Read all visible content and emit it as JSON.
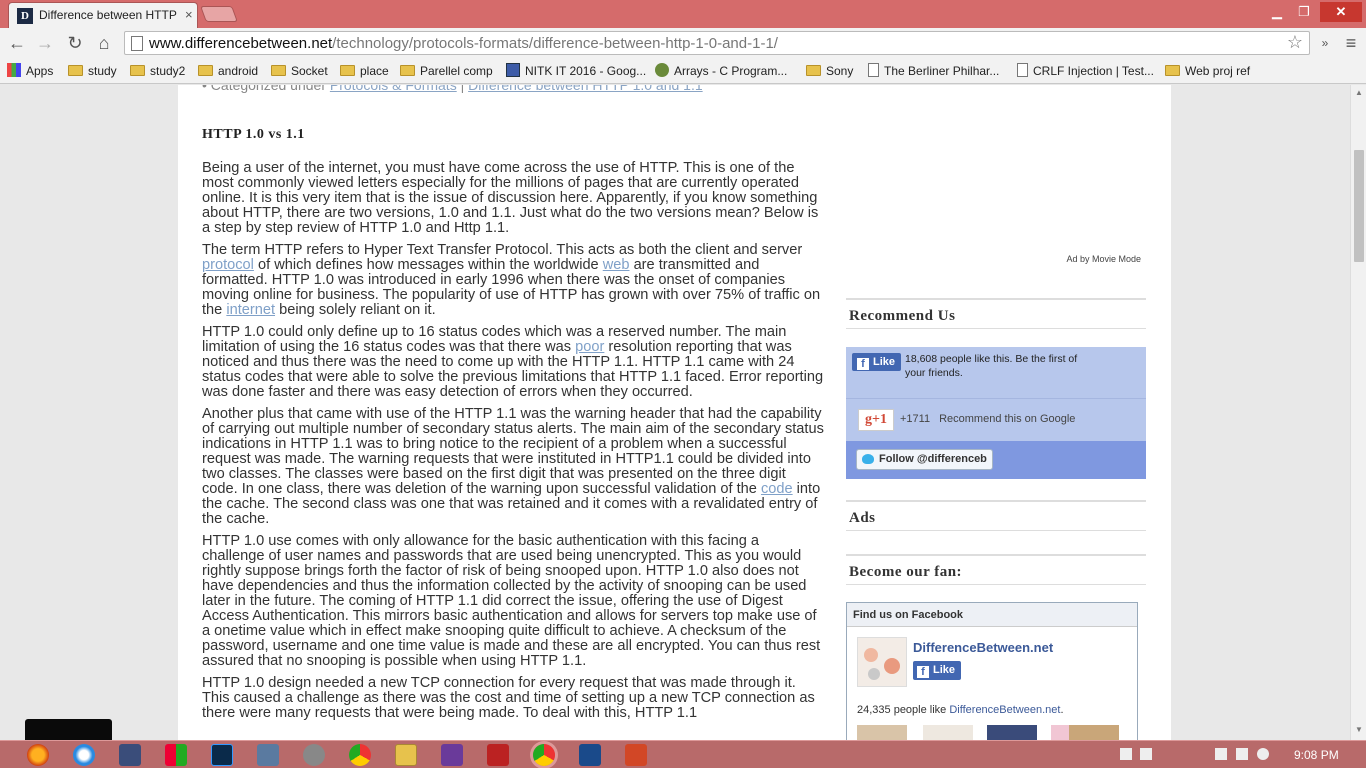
{
  "browser": {
    "tab_title": "Difference between HTTP",
    "favicon_letter": "D",
    "url_host": "www.differencebetween.net",
    "url_path": "/technology/protocols-formats/difference-between-http-1-0-and-1-1/",
    "bookmarks": [
      {
        "label": "Apps",
        "icon": "apps-grid-icon"
      },
      {
        "label": "study",
        "icon": "folder-icon"
      },
      {
        "label": "study2",
        "icon": "folder-icon"
      },
      {
        "label": "android",
        "icon": "folder-icon"
      },
      {
        "label": "Socket",
        "icon": "folder-icon"
      },
      {
        "label": "place",
        "icon": "folder-icon"
      },
      {
        "label": "Parellel comp",
        "icon": "folder-icon"
      },
      {
        "label": "NITK IT 2016 - Goog...",
        "icon": "google-form-icon"
      },
      {
        "label": "Arrays - C Program...",
        "icon": "dragon-icon"
      },
      {
        "label": "Sony",
        "icon": "folder-icon"
      },
      {
        "label": "The Berliner Philhar...",
        "icon": "page-icon"
      },
      {
        "label": "CRLF Injection | Test...",
        "icon": "page-icon"
      },
      {
        "label": "Web proj ref",
        "icon": "folder-icon"
      }
    ]
  },
  "article": {
    "crumb_prefix": "• Categorized under",
    "crumb_link1": "Protocols & Formats",
    "crumb_sep": " | ",
    "crumb_link2": "Difference between HTTP 1.0 and 1.1",
    "title": "HTTP 1.0 vs 1.1",
    "p1": "Being a user of the internet, you must have come across the use of HTTP. This is one of the most commonly viewed letters especially for the millions of pages that are currently operated online. It is this very item that is the issue of discussion here. Apparently, if you know something about HTTP, there are two versions, 1.0 and 1.1. Just what do the two versions mean? Below is a step by step review of HTTP 1.0 and Http 1.1.",
    "p2_a": "The term HTTP refers to Hyper Text Transfer Protocol. This acts as both the client and server ",
    "p2_link1": "protocol",
    "p2_b": " of which defines how messages within the worldwide ",
    "p2_link2": "web",
    "p2_c": " are transmitted and formatted. HTTP 1.0 was introduced in early 1996 when there was the onset of companies moving online for business.  The popularity of use of HTTP has grown with over 75% of traffic on the ",
    "p2_link3": "internet",
    "p2_d": " being solely reliant on it.",
    "p3_a": "HTTP 1.0 could only define up to 16 status codes which was a reserved number. The main limitation of using the 16 status codes was that there was ",
    "p3_link": "poor",
    "p3_b": " resolution reporting that was noticed and thus there was the need to come up with the HTTP 1.1. HTTP 1.1 came with 24 status codes that were able to solve the previous limitations that HTTP 1.1 faced. Error reporting was done faster and there was easy detection of errors when they occurred.",
    "p4_a": "Another plus that came with use of the HTTP 1.1 was the warning header that had the capability of carrying out multiple number of secondary status alerts. The main aim of the secondary status indications in HTTP 1.1 was to bring notice to the recipient of a problem when a successful request was made. The warning requests that were instituted in HTTP1.1 could be divided into two classes.  The classes were based on the first digit that was presented on the three digit code.  In one class, there was deletion of the warning upon successful validation of the ",
    "p4_link": "code",
    "p4_b": " into the cache. The second class was one that was retained and it comes with a revalidated entry of the cache.",
    "p5": "HTTP 1.0 use comes with only allowance for the basic authentication with this facing a challenge of user names and passwords that are used being unencrypted. This as you would rightly suppose brings forth the factor of risk of being snooped upon. HTTP 1.0 also does not have dependencies and thus the information collected by the activity of snooping can be used later in the future. The coming of HTTP 1.1 did correct the issue, offering the use of Digest Access Authentication. This mirrors basic authentication and allows for servers top make use of a onetime value which in effect make snooping quite difficult to achieve. A checksum of the password, username and one time value is made and these are all encrypted. You can thus rest assured that no snooping is possible when using HTTP 1.1.",
    "p6": "HTTP 1.0 design needed a new TCP connection for every request that was made through it. This caused a challenge as there was the cost and time of setting up a new TCP connection as there were many requests that were being made. To deal with this, HTTP 1.1"
  },
  "sidebar": {
    "ad_by": "Ad by Movie Mode",
    "recommend_heading": "Recommend Us",
    "fb_like": "Like",
    "fb_text": "18,608 people like this. Be the first of your friends.",
    "gplus_label": "g+1",
    "gplus_count": "+1711",
    "gplus_text": "Recommend this on Google",
    "twitter_follow": "Follow @differenceb",
    "ads_heading": "Ads",
    "fan_heading": "Become our fan:",
    "fanbox_title": "Find us on Facebook",
    "fanbox_name": "DifferenceBetween.net",
    "fanbox_like": "Like",
    "fanbox_count_a": "24,335 people like ",
    "fanbox_count_link": "DifferenceBetween.net",
    "fanbox_count_b": "."
  },
  "taskbar": {
    "time": "9:08 PM",
    "apps": [
      "firefox-icon",
      "ie-icon",
      "sql-icon",
      "office-icon",
      "photoshop-icon",
      "hyperterminal-icon",
      "settings-icon",
      "chrome-icon",
      "explorer-icon",
      "visual-studio-icon",
      "filezilla-icon",
      "chrome-active-icon",
      "vpn-icon",
      "powerpoint-icon"
    ]
  },
  "colors": {
    "titlebar": "#d56b6b",
    "taskbar": "#b86a6a",
    "link": "#7fa0c8",
    "fb_row": "#b7c7ec",
    "twitter_row": "#7f98e0"
  }
}
